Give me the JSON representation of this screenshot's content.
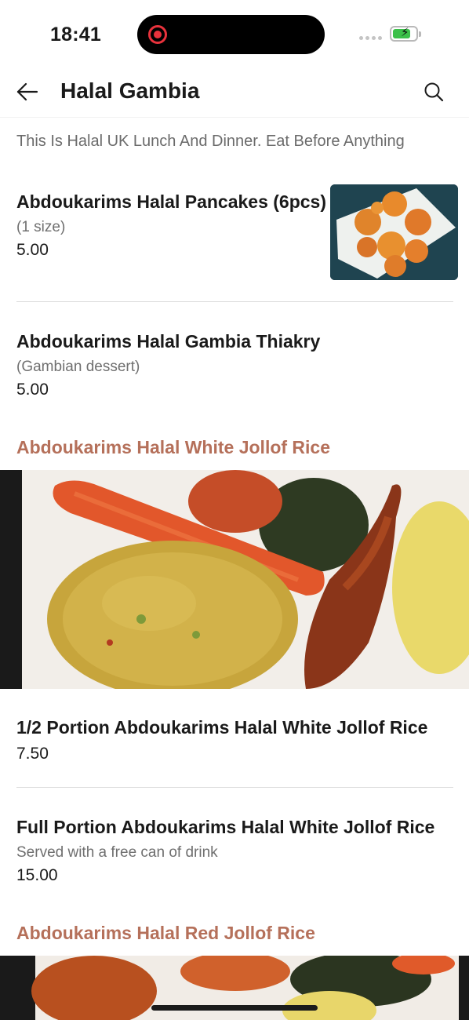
{
  "status_bar": {
    "time": "18:41",
    "recording_icon": "screen-record-icon",
    "battery_color": "#3cc04a"
  },
  "header": {
    "title": "Halal Gambia",
    "back_icon": "arrow-left-icon",
    "search_icon": "search-icon"
  },
  "intro": "This Is Halal UK Lunch And Dinner. Eat Before Anything",
  "items_top": [
    {
      "name": "Abdoukarims Halal Pancakes (6pcs)",
      "description": "(1 size)",
      "price": "5.00"
    },
    {
      "name": "Abdoukarims Halal Gambia Thiakry",
      "description": "(Gambian dessert)",
      "price": "5.00"
    }
  ],
  "sections": [
    {
      "title": "Abdoukarims Halal White Jollof Rice",
      "items": [
        {
          "name": "1/2 Portion Abdoukarims Halal White Jollof Rice",
          "price": "7.50"
        },
        {
          "name": "Full Portion Abdoukarims Halal White Jollof Rice",
          "description": "Served with a free can of drink",
          "price": "15.00"
        }
      ]
    },
    {
      "title": "Abdoukarims Halal Red Jollof Rice"
    }
  ],
  "colors": {
    "accent": "#b5705a",
    "text_primary": "#1a1a1a",
    "text_secondary": "#6f6f6f"
  }
}
